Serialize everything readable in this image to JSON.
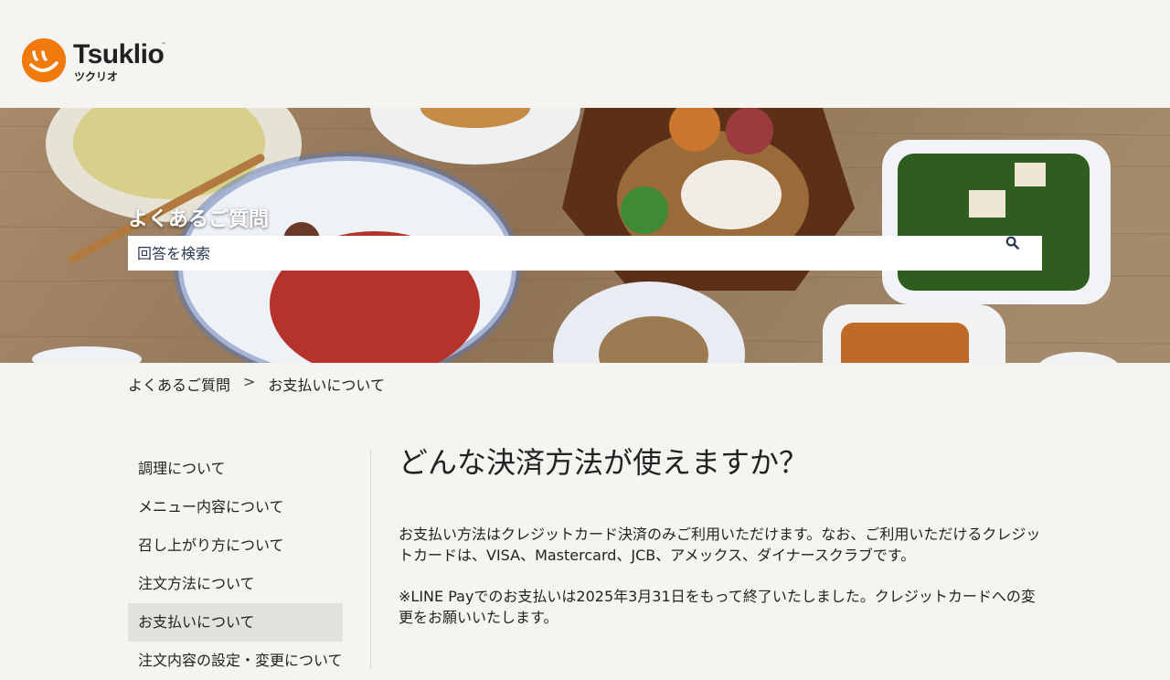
{
  "header": {
    "logo_text": "Tsuklio",
    "logo_tm": "™",
    "logo_kana": "ツクリオ",
    "brand_color": "#f07a0c"
  },
  "hero": {
    "title": "よくあるご質問",
    "search": {
      "placeholder": "回答を検索",
      "value": "",
      "icon": "search-icon"
    }
  },
  "breadcrumb": {
    "items": [
      "よくあるご質問",
      "お支払いについて"
    ],
    "separator": ">"
  },
  "sidebar": {
    "items": [
      {
        "label": "調理について",
        "active": false
      },
      {
        "label": "メニュー内容について",
        "active": false
      },
      {
        "label": "召し上がり方について",
        "active": false
      },
      {
        "label": "注文方法について",
        "active": false
      },
      {
        "label": "お支払いについて",
        "active": true
      },
      {
        "label": "注文内容の設定・変更について",
        "active": false
      }
    ]
  },
  "article": {
    "title": "どんな決済方法が使えますか？",
    "paragraphs": [
      "お支払い方法はクレジットカード決済のみご利用いただけます。なお、ご利用いただけるクレジットカードは、VISA、Mastercard、JCB、アメックス、ダイナースクラブです。",
      "※LINE Payでのお支払いは2025年3月31日をもって終了いたしました。クレジットカードへの変更をお願いいたします。"
    ]
  }
}
